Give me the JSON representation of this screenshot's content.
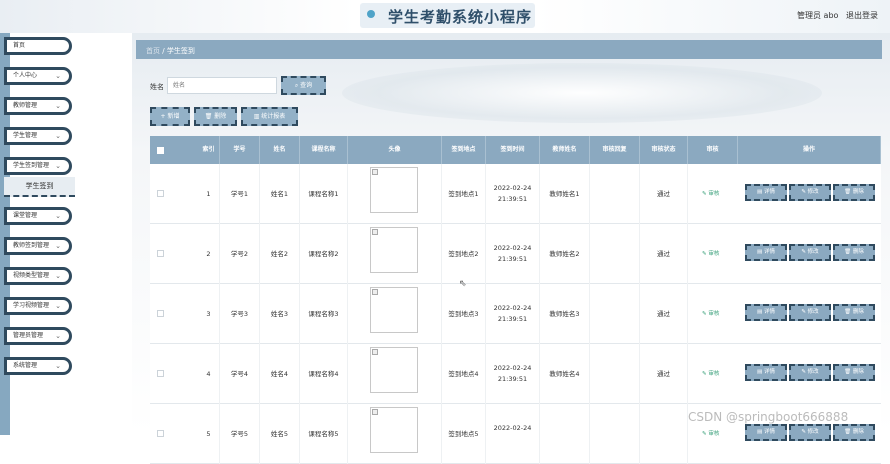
{
  "header": {
    "app_title": "学生考勤系统小程序",
    "user": "管理员 abo",
    "logout": "退出登录"
  },
  "sidebar": {
    "items": [
      {
        "label": "首页"
      },
      {
        "label": "个人中心"
      },
      {
        "label": "教师管理"
      },
      {
        "label": "学生管理"
      },
      {
        "label": "学生签到管理"
      },
      {
        "label": "课堂管理"
      },
      {
        "label": "教师签到管理"
      },
      {
        "label": "视频类型管理"
      },
      {
        "label": "学习视频管理"
      },
      {
        "label": "管理员管理"
      },
      {
        "label": "系统管理"
      }
    ],
    "active_sub": "学生签到"
  },
  "breadcrumb": {
    "home": "首页",
    "sep": "/",
    "current": "学生签到"
  },
  "search": {
    "label": "姓名",
    "placeholder": "姓名",
    "button": "查询"
  },
  "actions": {
    "add": "+ 新增",
    "delete": "删除",
    "stats": "统计报表"
  },
  "table": {
    "columns": [
      "索引",
      "学号",
      "姓名",
      "课程名称",
      "头像",
      "签到地点",
      "签到时间",
      "教师姓名",
      "审核回复",
      "审核状态",
      "审核",
      "操作"
    ],
    "audit_label": "审核",
    "op_labels": {
      "detail": "详情",
      "edit": "修改",
      "delete": "删除"
    },
    "rows": [
      {
        "index": "1",
        "student_no": "学号1",
        "name": "姓名1",
        "course": "课程名称1",
        "location": "签到地点1",
        "date": "2022-02-24",
        "time": "21:39:51",
        "teacher": "教师姓名1",
        "reply": "",
        "status": "通过"
      },
      {
        "index": "2",
        "student_no": "学号2",
        "name": "姓名2",
        "course": "课程名称2",
        "location": "签到地点2",
        "date": "2022-02-24",
        "time": "21:39:51",
        "teacher": "教师姓名2",
        "reply": "",
        "status": "通过"
      },
      {
        "index": "3",
        "student_no": "学号3",
        "name": "姓名3",
        "course": "课程名称3",
        "location": "签到地点3",
        "date": "2022-02-24",
        "time": "21:39:51",
        "teacher": "教师姓名3",
        "reply": "",
        "status": "通过"
      },
      {
        "index": "4",
        "student_no": "学号4",
        "name": "姓名4",
        "course": "课程名称4",
        "location": "签到地点4",
        "date": "2022-02-24",
        "time": "21:39:51",
        "teacher": "教师姓名4",
        "reply": "",
        "status": "通过"
      },
      {
        "index": "5",
        "student_no": "学号5",
        "name": "姓名5",
        "course": "课程名称5",
        "location": "签到地点5",
        "date": "2022-02-24",
        "time": "",
        "teacher": "",
        "reply": "",
        "status": ""
      }
    ]
  },
  "watermark": "CSDN @springboot666888",
  "colors": {
    "accent": "#8ba9c0",
    "border": "#2f4a5e",
    "audit": "#3aa07a"
  }
}
